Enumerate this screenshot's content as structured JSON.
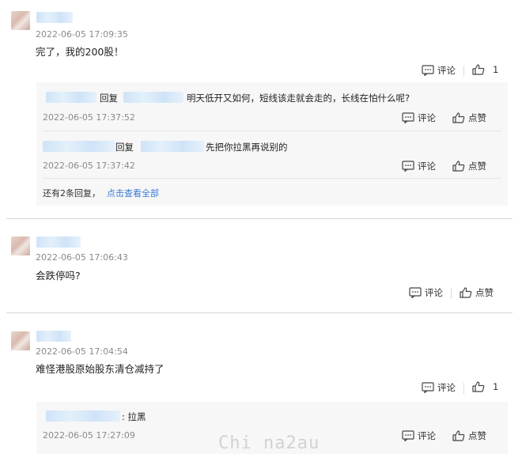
{
  "comments": [
    {
      "date": "2022-06-05 17:09:35",
      "text": "完了，我的200股！",
      "reply_label": "评论",
      "like_count": "1",
      "replies": [
        {
          "reply_word": "回复",
          "text": "明天低开又如何，短线该走就会走的，长线在怕什么呢?",
          "date": "2022-06-05 17:37:52",
          "reply_label": "评论",
          "like_label": "点赞"
        },
        {
          "reply_word": "回复",
          "text": "先把你拉黑再说别的",
          "date": "2022-06-05 17:37:42",
          "reply_label": "评论",
          "like_label": "点赞"
        }
      ],
      "more": {
        "text": "还有2条回复，",
        "link": "点击查看全部"
      }
    },
    {
      "date": "2022-06-05 17:06:43",
      "text": "会跌停吗?",
      "reply_label": "评论",
      "like_label": "点赞"
    },
    {
      "date": "2022-06-05 17:04:54",
      "text": "难怪港股原始股东清仓减持了",
      "reply_label": "评论",
      "like_count": "1",
      "replies": [
        {
          "text": ": 拉黑",
          "date": "2022-06-05 17:27:09",
          "reply_label": "评论",
          "like_label": "点赞"
        }
      ]
    }
  ],
  "watermark": "Chi na2au",
  "icons": {
    "comment": "comment-icon",
    "like": "thumbs-up-icon"
  },
  "colors": {
    "link": "#3a7bd5",
    "name_blur": "#cfe3f7",
    "reply_bg": "#f7f7f7"
  }
}
